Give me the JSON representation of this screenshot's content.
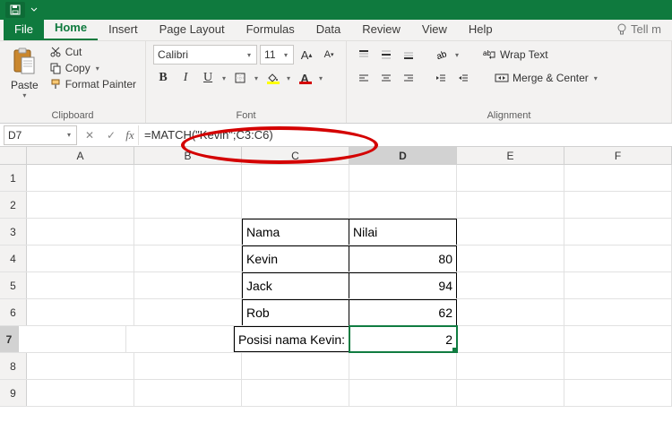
{
  "qat": {
    "save": "save-icon"
  },
  "tabs": {
    "file": "File",
    "home": "Home",
    "insert": "Insert",
    "pageLayout": "Page Layout",
    "formulas": "Formulas",
    "data": "Data",
    "review": "Review",
    "view": "View",
    "help": "Help",
    "tellme": "Tell m"
  },
  "clipboard": {
    "paste": "Paste",
    "cut": "Cut",
    "copy": "Copy",
    "formatPainter": "Format Painter",
    "groupLabel": "Clipboard"
  },
  "font": {
    "name": "Calibri",
    "size": "11",
    "bold": "B",
    "italic": "I",
    "underline": "U",
    "groupLabel": "Font",
    "fillColor": "#ffff00",
    "fontColor": "#d40000"
  },
  "alignment": {
    "wrapText": "Wrap Text",
    "mergeCenter": "Merge & Center",
    "groupLabel": "Alignment"
  },
  "namebox": "D7",
  "formula": "=MATCH(\"Kevin\";C3:C6)",
  "columns": [
    "A",
    "B",
    "C",
    "D",
    "E",
    "F"
  ],
  "rows": [
    1,
    2,
    3,
    4,
    5,
    6,
    7,
    8,
    9
  ],
  "cells": {
    "C3": "Nama",
    "D3": "Nilai",
    "C4": "Kevin",
    "D4": "80",
    "C5": "Jack",
    "D5": "94",
    "C6": "Rob",
    "D6": "62",
    "C7": "Posisi nama Kevin:",
    "D7": "2"
  },
  "selected": {
    "col": "D",
    "row": 7
  }
}
